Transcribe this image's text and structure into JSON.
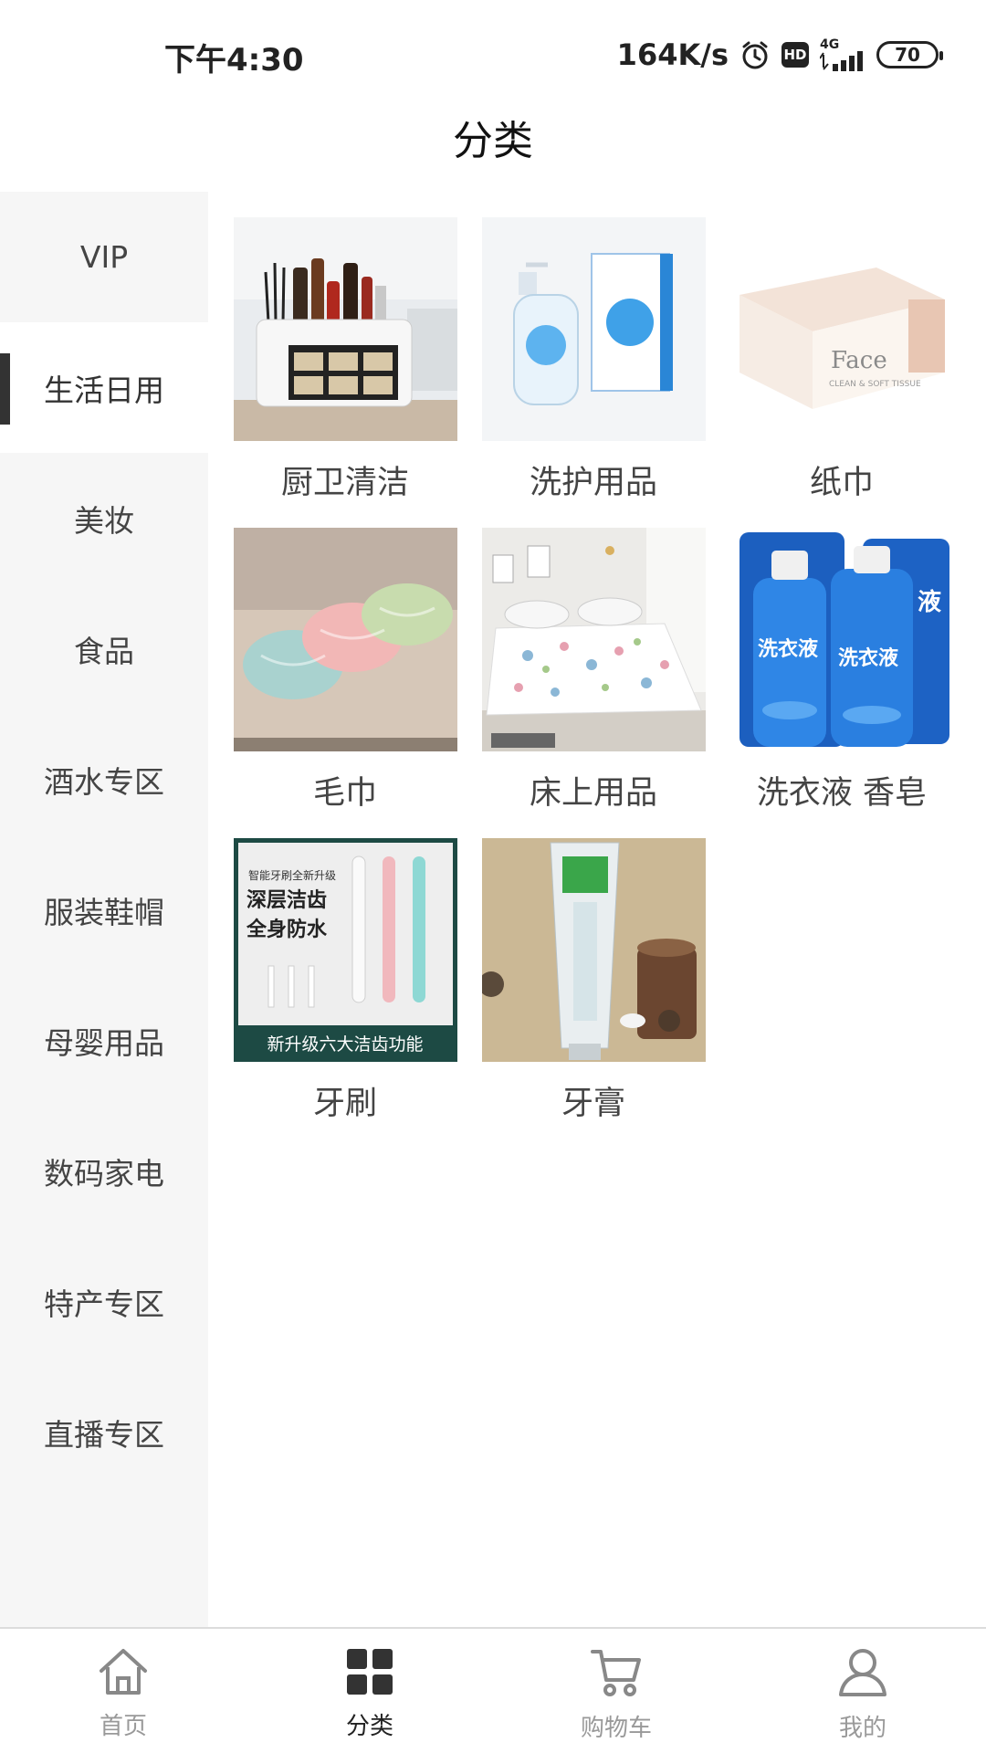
{
  "status_bar": {
    "time": "下午4:30",
    "net_speed": "164K/s",
    "hd": "HD",
    "signal_type": "4G",
    "battery": "70"
  },
  "header": {
    "title": "分类"
  },
  "sidebar": {
    "items": [
      {
        "label": "VIP"
      },
      {
        "label": "生活日用"
      },
      {
        "label": "美妆"
      },
      {
        "label": "食品"
      },
      {
        "label": "酒水专区"
      },
      {
        "label": "服装鞋帽"
      },
      {
        "label": "母婴用品"
      },
      {
        "label": "数码家电"
      },
      {
        "label": "特产专区"
      },
      {
        "label": "直播专区"
      }
    ],
    "active_index": 1
  },
  "categories": [
    {
      "label": "厨卫清洁",
      "icon": "kitchen-rack-image"
    },
    {
      "label": "洗护用品",
      "icon": "lotion-bottle-image"
    },
    {
      "label": "纸巾",
      "icon": "tissue-box-image",
      "image_text": {
        "brand": "Face",
        "sub": "CLEAN & SOFT TISSUE"
      }
    },
    {
      "label": "毛巾",
      "icon": "towels-image"
    },
    {
      "label": "床上用品",
      "icon": "bedding-image"
    },
    {
      "label": "洗衣液 香皂",
      "icon": "laundry-detergent-image",
      "image_text": {
        "brand": "洗衣液",
        "side": "液"
      }
    },
    {
      "label": "牙刷",
      "icon": "electric-toothbrush-image",
      "image_text": {
        "line1": "智能牙刷全新升级",
        "line2": "深层洁齿",
        "line3": "全身防水",
        "banner": "新升级六大洁齿功能"
      }
    },
    {
      "label": "牙膏",
      "icon": "toothpaste-image"
    }
  ],
  "tab_bar": {
    "items": [
      {
        "label": "首页",
        "icon": "home-icon"
      },
      {
        "label": "分类",
        "icon": "grid-icon"
      },
      {
        "label": "购物车",
        "icon": "cart-icon"
      },
      {
        "label": "我的",
        "icon": "user-icon"
      }
    ],
    "active_index": 1
  },
  "colors": {
    "accent": "#333333",
    "sidebar_bg": "#f6f6f6",
    "detergent_blue": "#1f6fd6"
  }
}
